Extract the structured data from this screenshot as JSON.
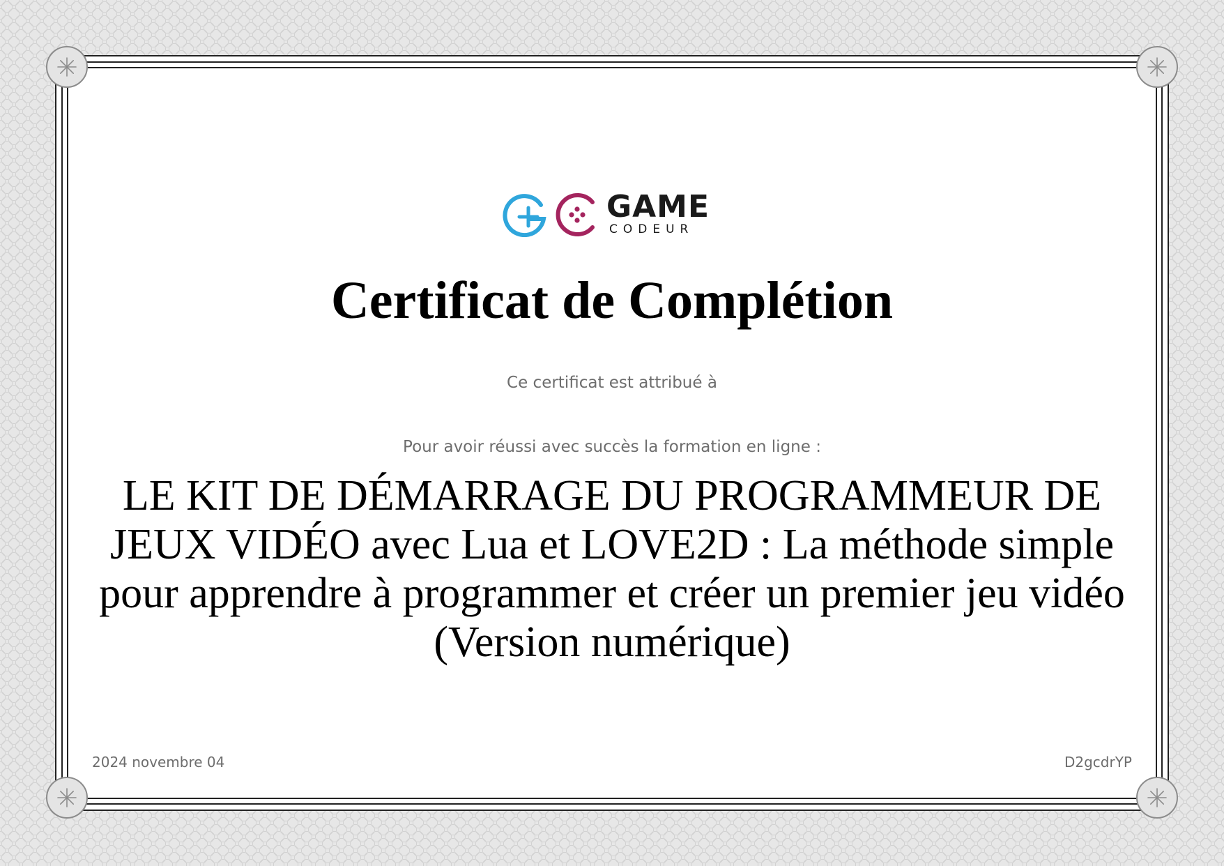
{
  "logo": {
    "name_main": "GAME",
    "name_sub": "CODEUR",
    "colors": {
      "blue": "#2fa6dc",
      "magenta": "#a4245e",
      "dark": "#1a1a1a"
    }
  },
  "certificate": {
    "title": "Certificat de Complétion",
    "awarded_to_label": "Ce certificat est attribué à",
    "recipient": "",
    "reason_label": "Pour avoir réussi avec succès la formation en ligne :",
    "course_title": "LE KIT DE DÉMARRAGE DU PROGRAMMEUR DE JEUX VIDÉO avec Lua et LOVE2D : La méthode simple pour apprendre à programmer et créer un premier jeu vidéo (Version numérique)",
    "date": "2024 novembre 04",
    "code": "D2gcdrYP"
  },
  "decorations": {
    "corner_icon": "asterisk-icon",
    "background_pattern": "interlocking-circles"
  }
}
